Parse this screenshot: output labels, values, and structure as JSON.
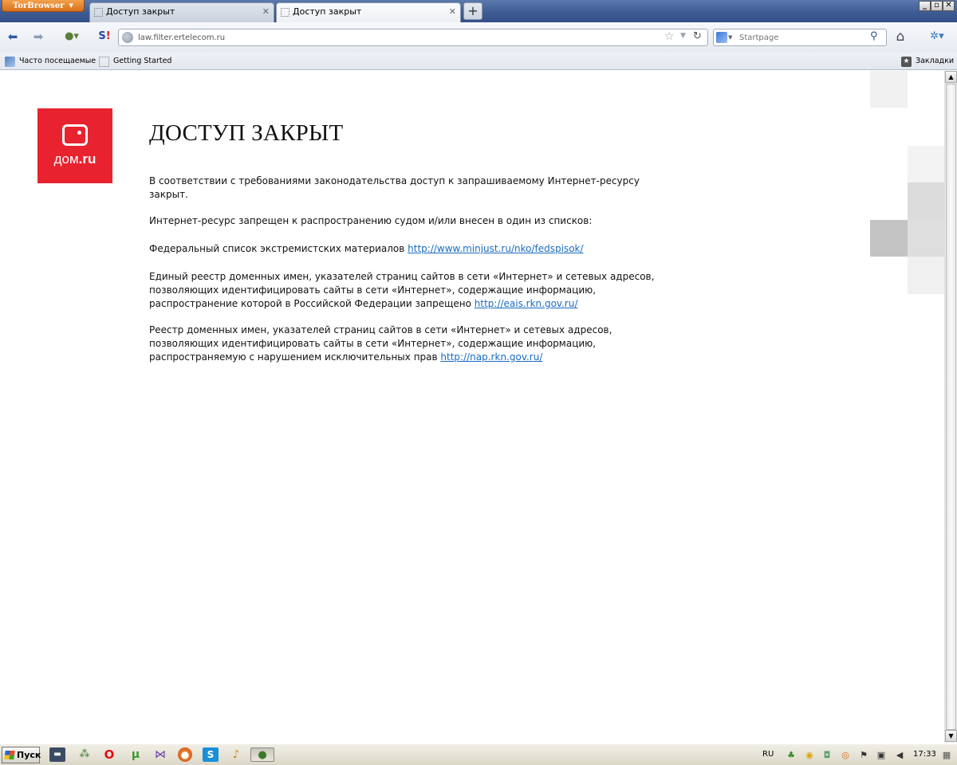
{
  "browser": {
    "tor_button_label": "TorBrowser",
    "tabs": [
      {
        "title": "Доступ закрыт",
        "active": false
      },
      {
        "title": "Доступ закрыт",
        "active": true
      }
    ],
    "new_tab_label": "+",
    "url": "law.filter.ertelecom.ru",
    "search_engine": "Startpage",
    "search_placeholder": "Startpage",
    "bookmarks": {
      "most_visited": "Часто посещаемые",
      "getting_started": "Getting Started",
      "bookmarks_menu": "Закладки"
    }
  },
  "page": {
    "logo_text_plain": "дом",
    "logo_text_bold": ".ru",
    "title": "ДОСТУП ЗАКРЫТ",
    "para_1": "В соответствии с требованиями законодательства доступ к запрашиваемому Интернет-ресурсу закрыт.",
    "para_2": "Интернет-ресурс запрещен к распространению судом и/или внесен в один из списков:",
    "para_3_text": "Федеральный список экстремистских материалов ",
    "para_3_link": "http://www.minjust.ru/nko/fedspisok/",
    "para_4_text": "Единый реестр доменных имен, указателей страниц сайтов в сети «Интернет» и сетевых адресов, позволяющих идентифицировать сайты в сети «Интернет», содержащие информацию, распространение которой в Российской Федерации запрещено ",
    "para_4_link": "http://eais.rkn.gov.ru/",
    "para_5_text": "Реестр доменных имен, указателей страниц сайтов в сети «Интернет» и сетевых адресов, позволяющих идентифицировать сайты в сети «Интернет», содержащие информацию, распространяемую с нарушением исключительных прав ",
    "para_5_link": "http://nap.rkn.gov.ru/"
  },
  "taskbar": {
    "start_label": "Пуск",
    "language": "RU",
    "clock": "17:33"
  },
  "colors": {
    "brand_red": "#e8232f",
    "link_blue": "#1a6bc2"
  }
}
